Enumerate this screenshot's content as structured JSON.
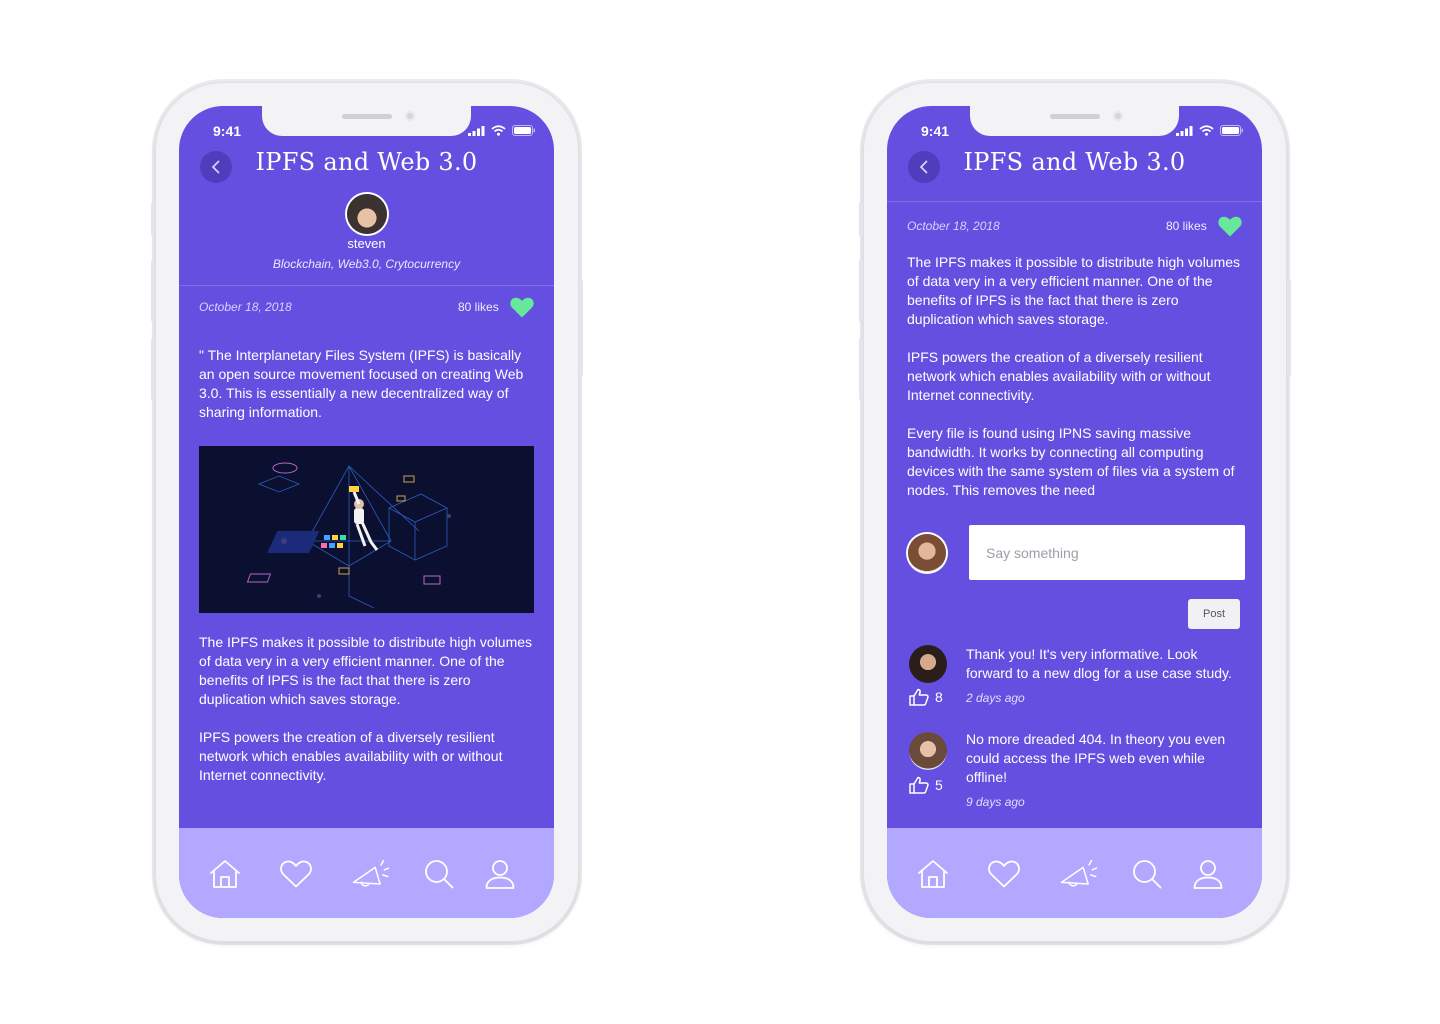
{
  "colors": {
    "primary": "#644fe0",
    "tabbar": "#b3a8ff",
    "heart": "#67e89a"
  },
  "left": {
    "status": {
      "time": "9:41"
    },
    "header": {
      "title": "IPFS and Web 3.0"
    },
    "author": {
      "name": "steven",
      "tags": "Blockchain, Web3.0, Crytocurrency"
    },
    "meta": {
      "date": "October 18, 2018",
      "likes": "80 likes"
    },
    "article": {
      "intro": "\" The Interplanetary Files System (IPFS) is basically an open source movement focused on creating Web 3.0. This is essentially a new decentralized way of sharing information.",
      "p1": "The IPFS makes it possible to distribute high volumes of data very in a very efficient manner. One of the benefits of IPFS is the fact that there is zero duplication which saves storage.",
      "p2": "IPFS powers the creation of a diversely resilient network which enables availability with or without Internet connectivity."
    },
    "tabs": [
      "home-icon",
      "heart-icon",
      "megaphone-icon",
      "search-icon",
      "profile-icon"
    ]
  },
  "right": {
    "status": {
      "time": "9:41"
    },
    "header": {
      "title": "IPFS and Web 3.0"
    },
    "meta": {
      "date": "October 18, 2018",
      "likes": "80 likes"
    },
    "article": {
      "p1": "The IPFS makes it possible to distribute high volumes of data very in a very efficient manner. One of the benefits of IPFS is the fact that there is zero duplication which saves storage.",
      "p2": "IPFS powers the creation of a diversely resilient network which enables availability with or without Internet connectivity.",
      "p3": "Every file is found using IPNS saving massive bandwidth. It works by connecting all computing devices with the same system of files via a system of nodes. This removes the need"
    },
    "comment_box": {
      "placeholder": "Say something",
      "post_label": "Post"
    },
    "comments": [
      {
        "text": "Thank you! It's very informative. Look forward to a new dlog for a use case study.",
        "time": "2 days ago",
        "likes": "8"
      },
      {
        "text": "No more dreaded 404. In theory you even could access the IPFS web even while offline!",
        "time": "9 days ago",
        "likes": "5"
      }
    ],
    "tabs": [
      "home-icon",
      "heart-icon",
      "megaphone-icon",
      "search-icon",
      "profile-icon"
    ]
  }
}
